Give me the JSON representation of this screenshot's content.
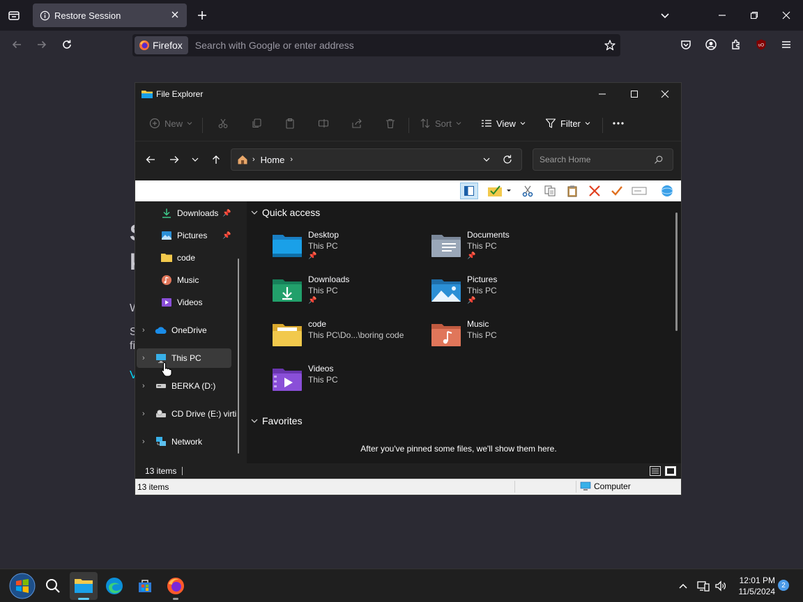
{
  "browser": {
    "tab": {
      "title": "Restore Session"
    },
    "urlbar": {
      "identity_label": "Firefox",
      "placeholder": "Search with Google or enter address"
    }
  },
  "background_page": {
    "fragments": [
      "S",
      "k",
      "W",
      "S",
      "fi",
      "V"
    ]
  },
  "explorer": {
    "title": "File Explorer",
    "commands": {
      "new": "New",
      "sort": "Sort",
      "view": "View",
      "filter": "Filter"
    },
    "address": {
      "segment": "Home"
    },
    "search": {
      "placeholder": "Search Home"
    },
    "nav": {
      "items": [
        {
          "label": "Downloads",
          "icon": "download-icon",
          "pinned": true
        },
        {
          "label": "Pictures",
          "icon": "pictures-icon",
          "pinned": true
        },
        {
          "label": "code",
          "icon": "folder-icon"
        },
        {
          "label": "Music",
          "icon": "music-icon"
        },
        {
          "label": "Videos",
          "icon": "videos-icon"
        },
        {
          "label": "OneDrive",
          "icon": "cloud-icon"
        },
        {
          "label": "This PC",
          "icon": "computer-icon",
          "selected": true
        },
        {
          "label": "BERKA (D:)",
          "icon": "drive-icon"
        },
        {
          "label": "CD Drive (E:) virti",
          "icon": "cd-drive-icon"
        },
        {
          "label": "Network",
          "icon": "network-icon"
        }
      ]
    },
    "quick_access": {
      "heading": "Quick access",
      "items": [
        {
          "name": "Desktop",
          "location": "This PC",
          "pinned": true,
          "color": "#1aa0e8"
        },
        {
          "name": "Documents",
          "location": "This PC",
          "pinned": true,
          "color": "#9aa7b8"
        },
        {
          "name": "Downloads",
          "location": "This PC",
          "pinned": true,
          "color": "#22a06b"
        },
        {
          "name": "Pictures",
          "location": "This PC",
          "pinned": true,
          "color": "#2b8fd6"
        },
        {
          "name": "code",
          "location": "This PC\\Do...\\boring code",
          "pinned": false,
          "color": "#f2c94c"
        },
        {
          "name": "Music",
          "location": "This PC",
          "pinned": false,
          "color": "#e0765a"
        },
        {
          "name": "Videos",
          "location": "This PC",
          "pinned": false,
          "color": "#8a4fd8"
        }
      ]
    },
    "favorites": {
      "heading": "Favorites",
      "empty_message": "After you've pinned some files, we'll show them here."
    },
    "status": {
      "count": "13 items"
    },
    "classic_status": {
      "count": "13 items",
      "location": "Computer"
    }
  },
  "taskbar": {
    "clock": {
      "time": "12:01 PM",
      "date": "11/5/2024"
    },
    "notification_count": "2"
  }
}
